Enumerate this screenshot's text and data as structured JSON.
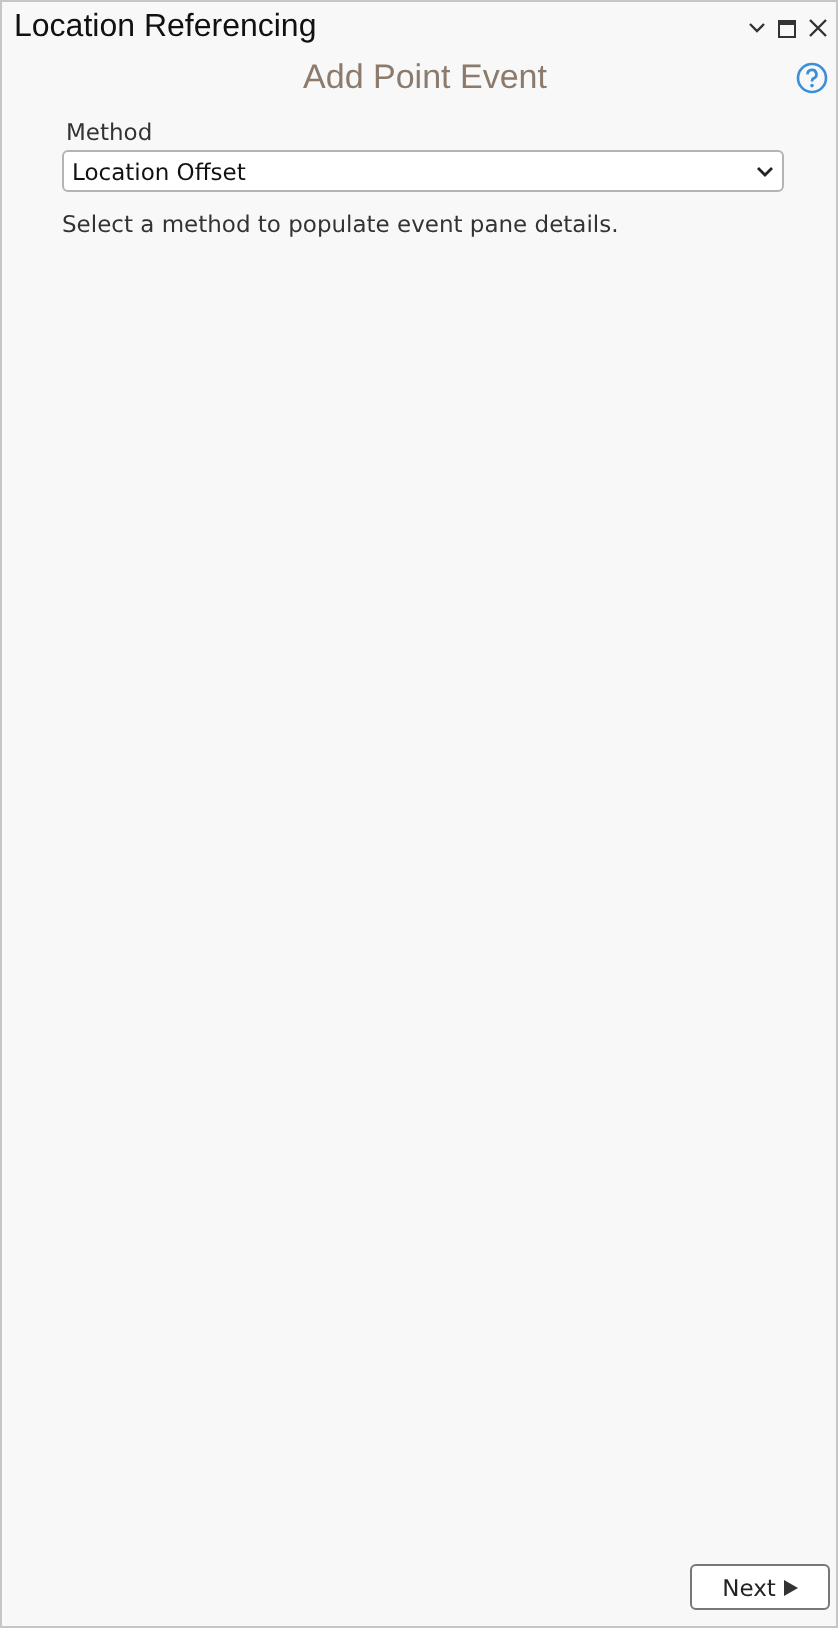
{
  "window": {
    "title": "Location Referencing"
  },
  "header": {
    "title": "Add Point Event"
  },
  "method": {
    "label": "Method",
    "value": "Location Offset",
    "hint": "Select a method to populate event pane details."
  },
  "buttons": [
    {
      "label": "Next"
    }
  ]
}
